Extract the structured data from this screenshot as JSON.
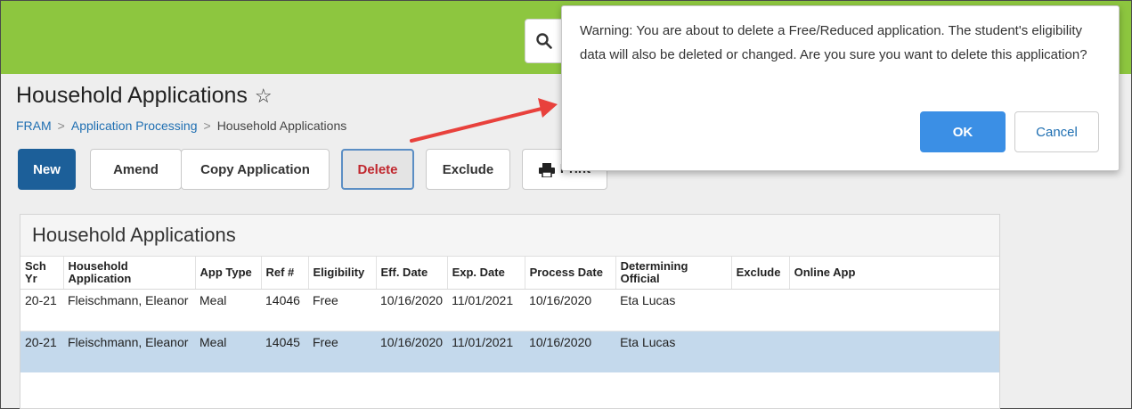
{
  "header": {
    "search_icon": "search-icon"
  },
  "page": {
    "title": "Household Applications",
    "star_icon": "star-outline-icon",
    "breadcrumb": [
      "FRAM",
      "Application Processing",
      "Household Applications"
    ],
    "breadcrumb_separator": ">"
  },
  "toolbar": {
    "new_label": "New",
    "amend_label": "Amend",
    "copy_label": "Copy Application",
    "delete_label": "Delete",
    "exclude_label": "Exclude",
    "print_label": "Print",
    "print_icon": "printer-icon"
  },
  "panel": {
    "title": "Household Applications",
    "columns": [
      "Sch Yr",
      "Household Application",
      "App Type",
      "Ref #",
      "Eligibility",
      "Eff. Date",
      "Exp. Date",
      "Process Date",
      "Determining Official",
      "Exclude",
      "Online App"
    ],
    "rows": [
      {
        "sch_yr": "20-21",
        "household": "Fleischmann, Eleanor",
        "app_type": "Meal",
        "ref": "14046",
        "eligibility": "Free",
        "eff_date": "10/16/2020",
        "exp_date": "11/01/2021",
        "process_date": "10/16/2020",
        "official": "Eta Lucas",
        "exclude": "",
        "online_app": "",
        "selected": false
      },
      {
        "sch_yr": "20-21",
        "household": "Fleischmann, Eleanor",
        "app_type": "Meal",
        "ref": "14045",
        "eligibility": "Free",
        "eff_date": "10/16/2020",
        "exp_date": "11/01/2021",
        "process_date": "10/16/2020",
        "official": "Eta Lucas",
        "exclude": "",
        "online_app": "",
        "selected": true
      }
    ]
  },
  "dialog": {
    "message": "Warning: You are about to delete a Free/Reduced application.  The student's eligibility data will also be deleted or changed.  Are you sure you want to delete this application?",
    "ok_label": "OK",
    "cancel_label": "Cancel"
  },
  "colors": {
    "header_green": "#8dc63f",
    "primary_blue": "#1c5f99",
    "ok_blue": "#3b8fe5",
    "delete_red": "#c0262d",
    "selected_row": "#c4d9ec",
    "annotation_arrow": "#e8413c"
  }
}
